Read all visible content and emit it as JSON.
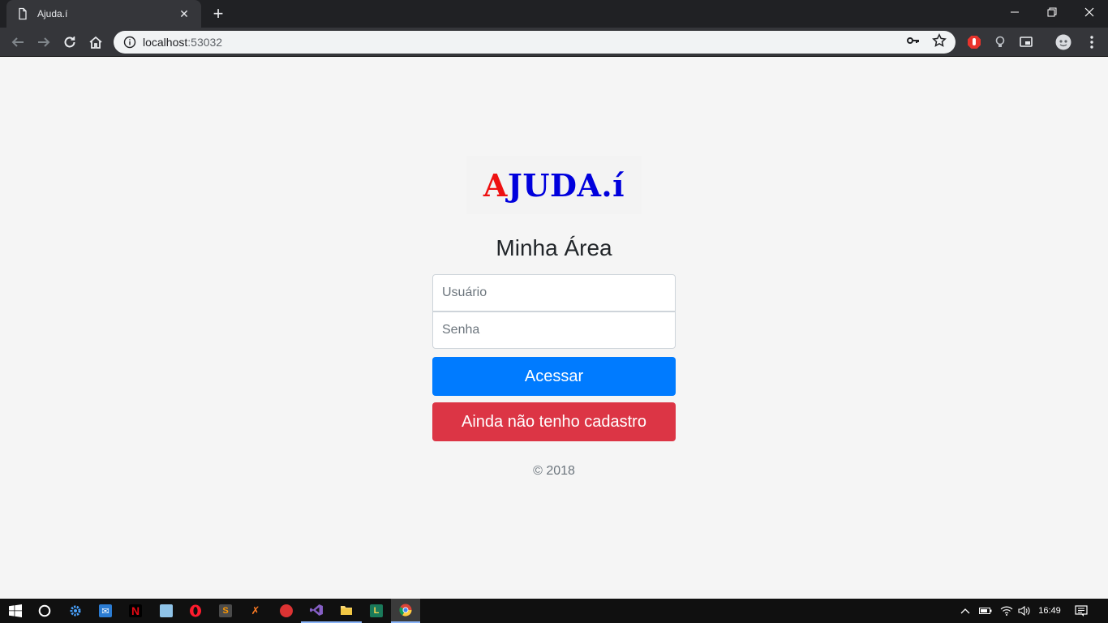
{
  "browser": {
    "tab_title": "Ajuda.í",
    "url_host": "localhost",
    "url_port": ":53032"
  },
  "page": {
    "logo": {
      "first_letter": "A",
      "rest": "JUDA.í"
    },
    "heading": "Minha Área",
    "username_placeholder": "Usuário",
    "password_placeholder": "Senha",
    "login_button": "Acessar",
    "signup_button": "Ainda não tenho cadastro",
    "copyright": "© 2018"
  },
  "colors": {
    "primary": "#007bff",
    "danger": "#dc3545",
    "logo_blue": "#0000dd",
    "logo_red": "#ee1111"
  },
  "taskbar": {
    "clock": "16:49",
    "apps": [
      "windows-start",
      "cortana",
      "settings",
      "outlook",
      "netflix",
      "notepad",
      "opera",
      "sublime",
      "xampp",
      "app-bird",
      "visual-studio",
      "file-explorer",
      "app-l",
      "chrome"
    ]
  }
}
